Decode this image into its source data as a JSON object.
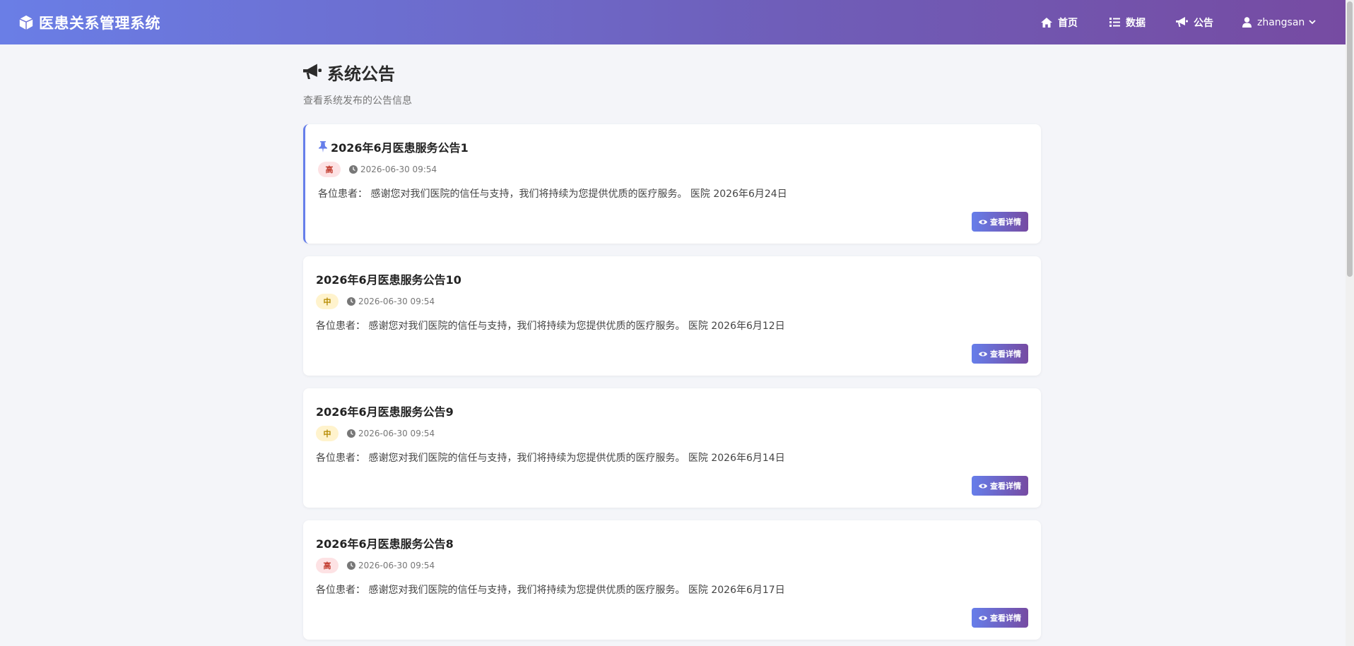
{
  "app": {
    "title": "医患关系管理系统"
  },
  "nav": {
    "home": "首页",
    "data": "数据",
    "notice": "公告",
    "user": "zhangsan"
  },
  "page": {
    "title": "系统公告",
    "subtitle": "查看系统发布的公告信息"
  },
  "colors": {
    "nav_gradient_start": "#667eea",
    "nav_gradient_end": "#764ba2",
    "priority_high_bg": "#fde2e4",
    "priority_mid_bg": "#fff3cd",
    "background": "#f4f5f9"
  },
  "notices": [
    {
      "title": "2026年6月医患服务公告1",
      "pinned": true,
      "priority": "高",
      "time": "2026-06-30 09:54",
      "content": "各位患者： 感谢您对我们医院的信任与支持，我们将持续为您提供优质的医疗服务。 医院 2026年6月24日",
      "button": "查看详情"
    },
    {
      "title": "2026年6月医患服务公告10",
      "pinned": false,
      "priority": "中",
      "time": "2026-06-30 09:54",
      "content": "各位患者： 感谢您对我们医院的信任与支持，我们将持续为您提供优质的医疗服务。 医院 2026年6月12日",
      "button": "查看详情"
    },
    {
      "title": "2026年6月医患服务公告9",
      "pinned": false,
      "priority": "中",
      "time": "2026-06-30 09:54",
      "content": "各位患者： 感谢您对我们医院的信任与支持，我们将持续为您提供优质的医疗服务。 医院 2026年6月14日",
      "button": "查看详情"
    },
    {
      "title": "2026年6月医患服务公告8",
      "pinned": false,
      "priority": "高",
      "time": "2026-06-30 09:54",
      "content": "各位患者： 感谢您对我们医院的信任与支持，我们将持续为您提供优质的医疗服务。 医院 2026年6月17日",
      "button": "查看详情"
    }
  ]
}
